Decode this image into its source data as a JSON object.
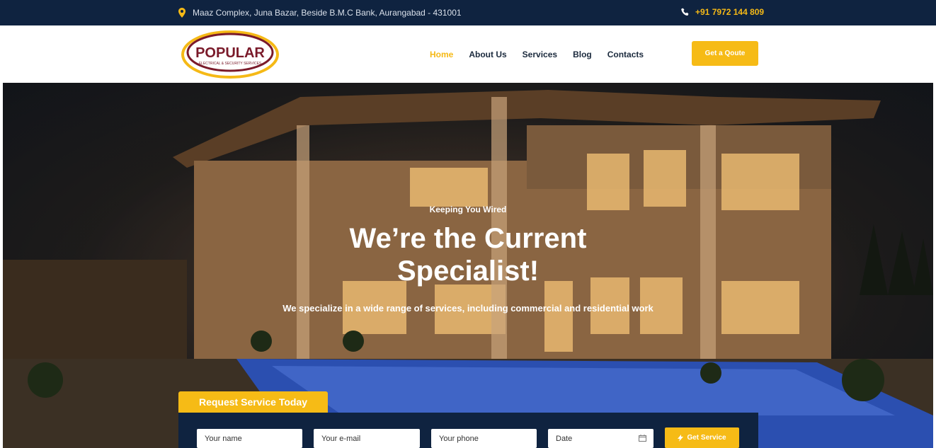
{
  "topbar": {
    "address": "Maaz Complex, Juna Bazar, Beside B.M.C Bank, Aurangabad - 431001",
    "address_icon": "map-pin-icon",
    "phone": "+91 7972 144 809",
    "phone_icon": "phone-icon"
  },
  "header": {
    "logo_text": "POPULAR",
    "logo_tagline": "ELECTRICAL & SECURITY SERVICES",
    "nav": [
      {
        "label": "Home",
        "active": true
      },
      {
        "label": "About Us",
        "active": false
      },
      {
        "label": "Services",
        "active": false
      },
      {
        "label": "Blog",
        "active": false
      },
      {
        "label": "Contacts",
        "active": false
      }
    ],
    "cta_label": "Get a Qoute"
  },
  "hero": {
    "kicker": "Keeping You Wired",
    "title_line1": "We’re the Current",
    "title_line2": "Specialist!",
    "subtitle": "We specialize in a wide range of services, including commercial and residential work"
  },
  "form": {
    "tab_label": "Request Service Today",
    "name_placeholder": "Your name",
    "email_placeholder": "Your e-mail",
    "phone_placeholder": "Your phone",
    "date_placeholder": "Date",
    "submit_label": "Get Service",
    "submit_icon": "bolt-icon",
    "date_icon": "calendar-icon"
  },
  "colors": {
    "navy": "#0f2340",
    "accent": "#f6bb16",
    "nav_text": "#1b2a3d"
  }
}
